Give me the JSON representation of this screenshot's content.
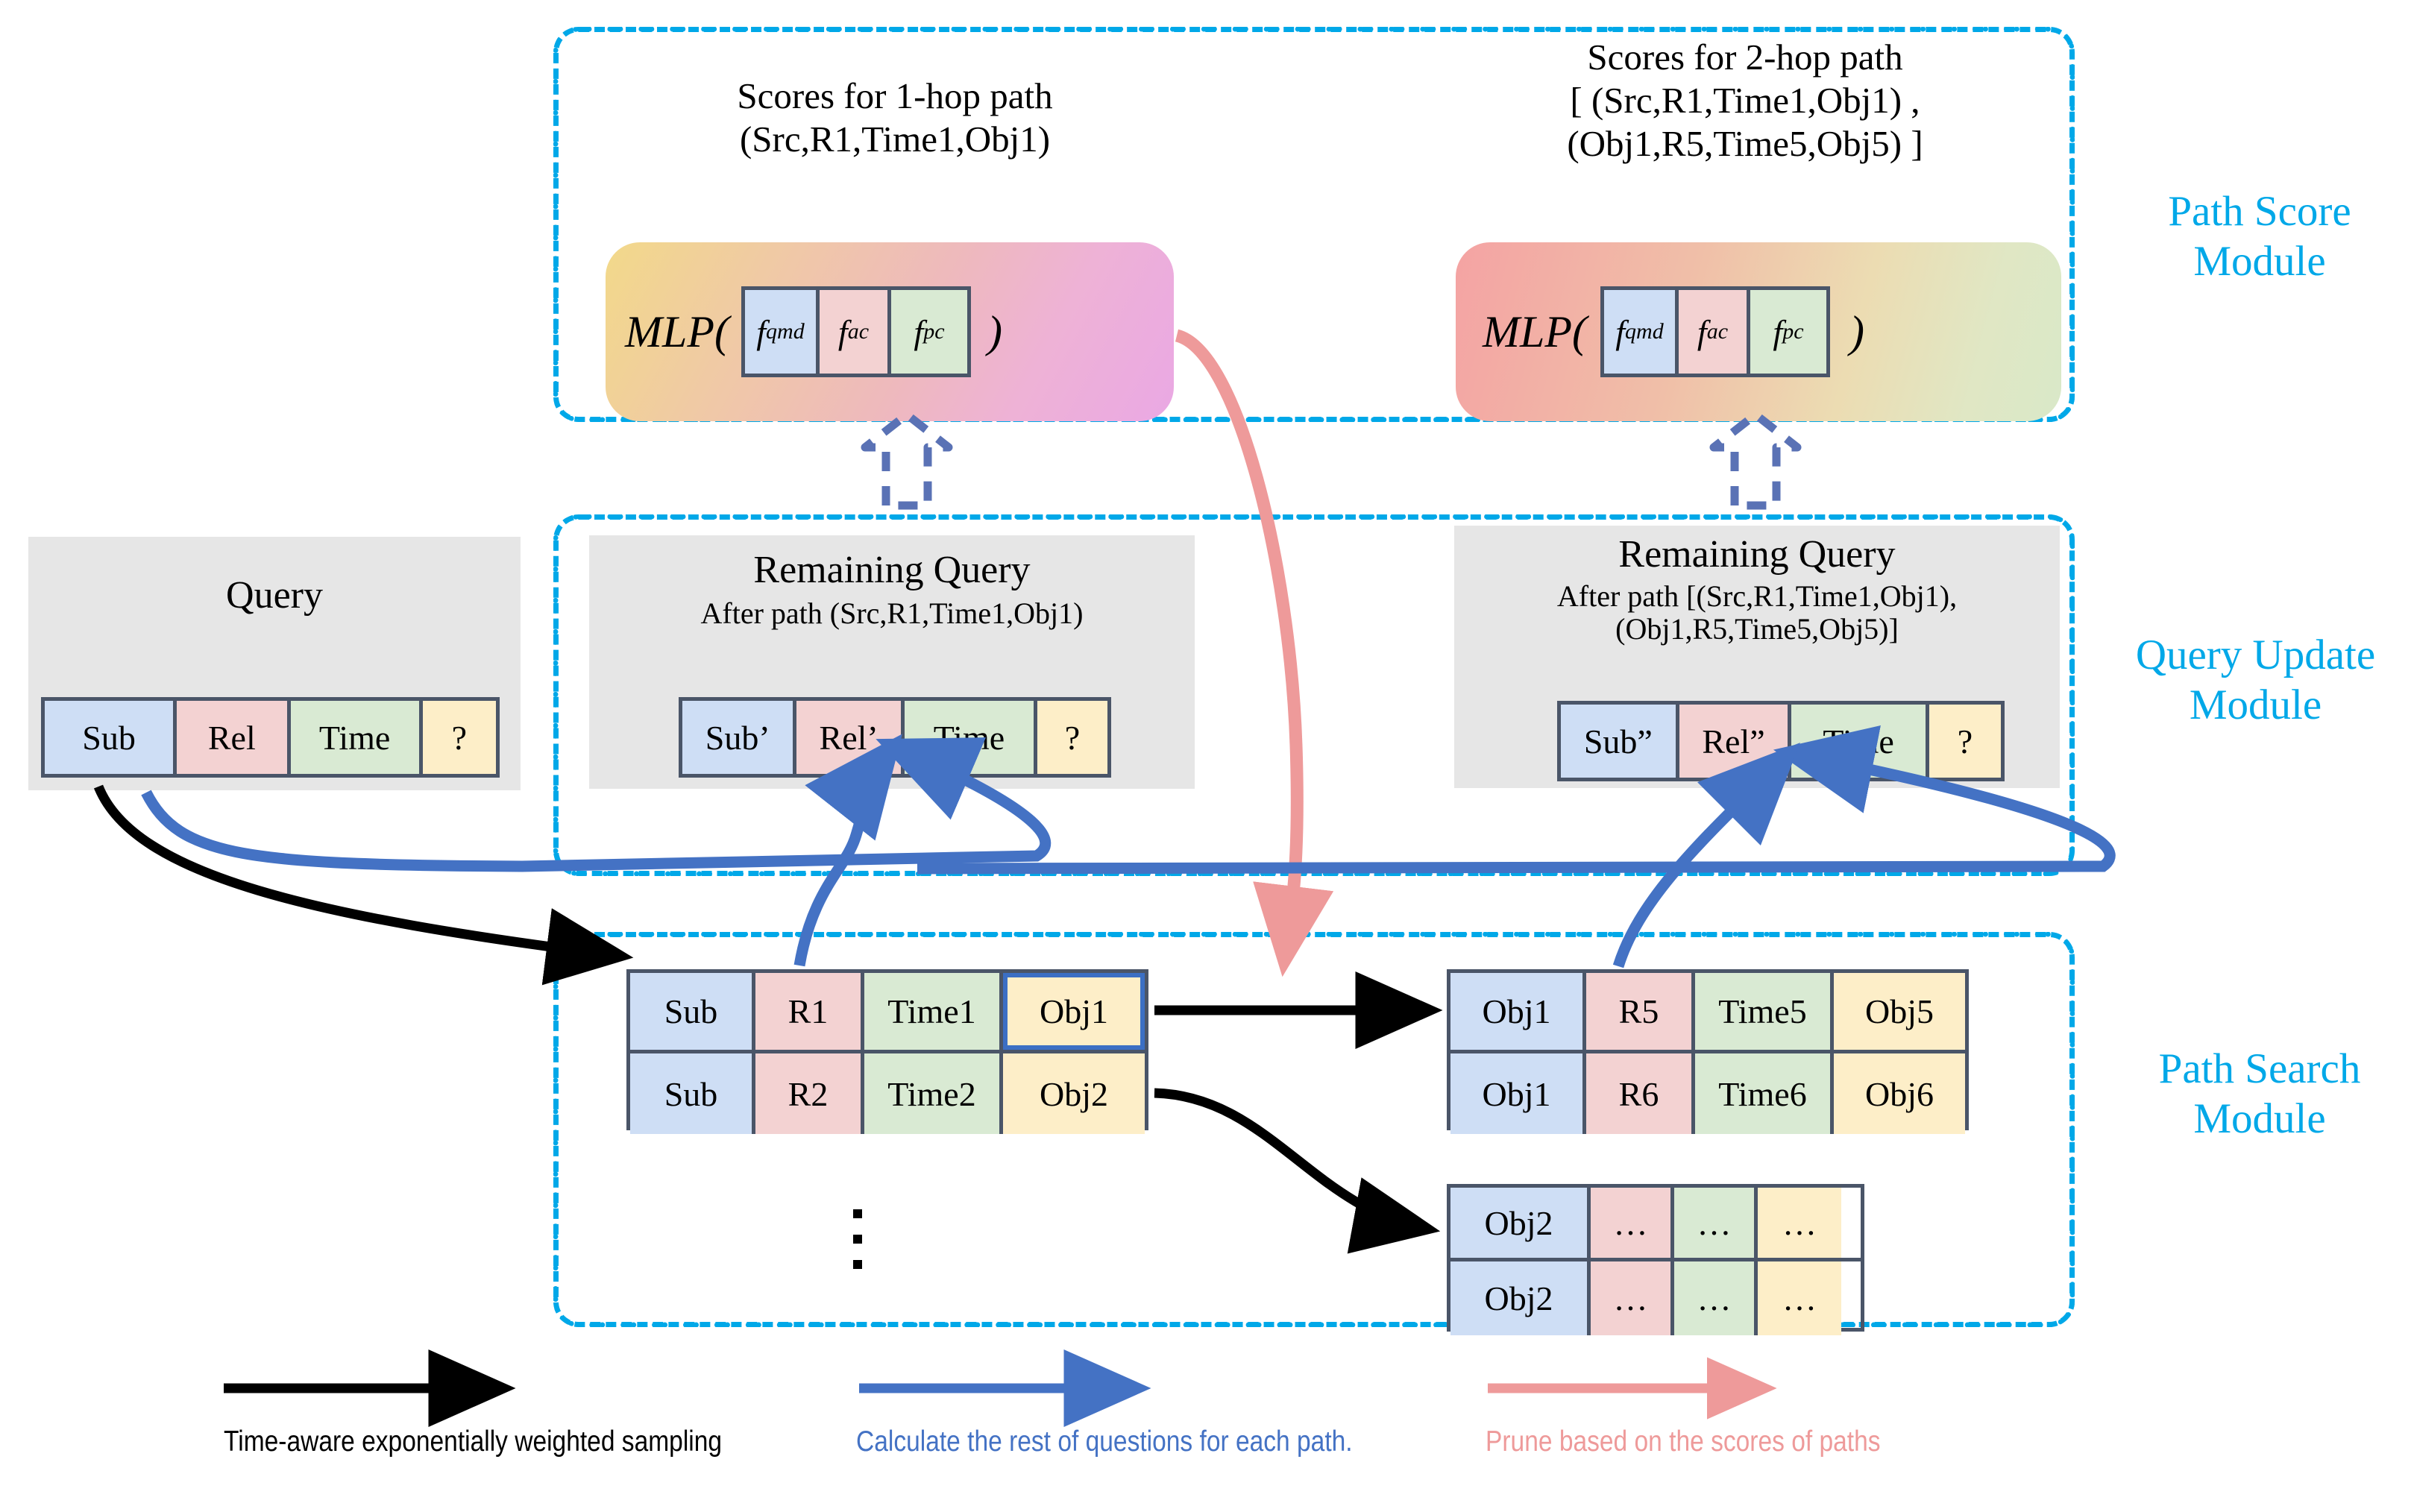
{
  "modules": [
    {
      "id": "path-score",
      "label": "Path Score\nModule"
    },
    {
      "id": "query-update",
      "label": "Query Update\nModule"
    },
    {
      "id": "path-search",
      "label": "Path Search\nModule"
    }
  ],
  "path_score": {
    "left": {
      "caption_line1": "Scores  for 1-hop path",
      "caption_line2": "(Src,R1,Time1,Obj1)",
      "mlp_prefix": "MLP(",
      "mlp_suffix": ")",
      "features": [
        {
          "name": "f",
          "sub": "qmd",
          "color": "#cedef5"
        },
        {
          "name": "f",
          "sub": "ac",
          "color": "#f3d2d2"
        },
        {
          "name": "f",
          "sub": "pc",
          "color": "#d9ead3"
        }
      ]
    },
    "right": {
      "caption_line1": "Scores for 2-hop path",
      "caption_line2": "[ (Src,R1,Time1,Obj1) ,",
      "caption_line3": "(Obj1,R5,Time5,Obj5) ]",
      "mlp_prefix": "MLP(",
      "mlp_suffix": ")",
      "features": [
        {
          "name": "f",
          "sub": "qmd",
          "color": "#cedef5"
        },
        {
          "name": "f",
          "sub": "ac",
          "color": "#f3d2d2"
        },
        {
          "name": "f",
          "sub": "pc",
          "color": "#d9ead3"
        }
      ]
    }
  },
  "query_update": {
    "query": {
      "title": "Query",
      "cells": [
        "Sub",
        "Rel",
        "Time",
        "?"
      ]
    },
    "remaining1": {
      "title": "Remaining Query",
      "subtitle": "After path (Src,R1,Time1,Obj1)",
      "cells": [
        "Sub’",
        "Rel’",
        "Time",
        "?"
      ]
    },
    "remaining2": {
      "title": "Remaining Query",
      "subtitle_line1": "After path [(Src,R1,Time1,Obj1),",
      "subtitle_line2": "(Obj1,R5,Time5,Obj5)]",
      "cells": [
        "Sub”",
        "Rel”",
        "Time",
        "?"
      ]
    }
  },
  "path_search": {
    "table_hop1": {
      "rows": [
        [
          "Sub",
          "R1",
          "Time1",
          "Obj1"
        ],
        [
          "Sub",
          "R2",
          "Time2",
          "Obj2"
        ]
      ],
      "highlight": {
        "row": 0,
        "col": 3
      }
    },
    "table_hop2_a": {
      "rows": [
        [
          "Obj1",
          "R5",
          "Time5",
          "Obj5"
        ],
        [
          "Obj1",
          "R6",
          "Time6",
          "Obj6"
        ]
      ]
    },
    "table_hop2_b": {
      "rows": [
        [
          "Obj2",
          "…",
          "…",
          "…"
        ],
        [
          "Obj2",
          "…",
          "…",
          "…"
        ]
      ]
    },
    "vertical_ellipsis": "⋮"
  },
  "legend": [
    {
      "color": "#000000",
      "text": "Time-aware exponentially weighted sampling"
    },
    {
      "color": "#4472c4",
      "text": "Calculate the rest of questions for each path."
    },
    {
      "color": "#ee9a9a",
      "text": "Prune based on the scores of paths"
    }
  ],
  "colors": {
    "module_border": "#00A8E8",
    "module_label": "#00A8E8",
    "cell_blue": "#cedef5",
    "cell_pink": "#f3d2d2",
    "cell_green": "#d9ead3",
    "cell_yellow": "#fdeec8",
    "cell_border": "#4a5568",
    "panel_gray": "#e6e6e6",
    "arrow_black": "#000000",
    "arrow_blue": "#4472c4",
    "arrow_pink": "#ee9a9a",
    "highlight_blue": "#3b6fc4",
    "dashed_arrow": "#5a72b5"
  }
}
